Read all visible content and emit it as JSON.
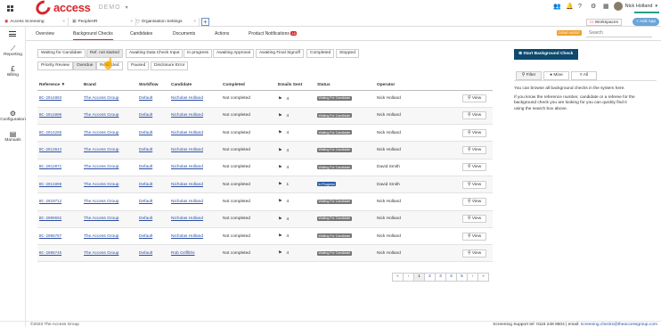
{
  "topbar": {
    "brand": "access",
    "demo_label": "DEMO",
    "user_name": "Nick Holland"
  },
  "app_tabs": [
    {
      "label": "Access Screening"
    },
    {
      "label": "PeopleHR"
    },
    {
      "label": "Organisation Settings"
    }
  ],
  "workspaces_label": "Workspaces",
  "add_app_label": "+ Add App",
  "sidebar": {
    "items": [
      {
        "label": "Reporting",
        "icon": "chart-icon"
      },
      {
        "label": "Billing",
        "icon": "pound-icon"
      },
      {
        "label": "Configuration",
        "icon": "gear-icon"
      },
      {
        "label": "Manuals",
        "icon": "book-icon"
      }
    ]
  },
  "nav": {
    "tabs": [
      {
        "label": "Overview"
      },
      {
        "label": "Background Checks"
      },
      {
        "label": "Candidates"
      },
      {
        "label": "Documents"
      },
      {
        "label": "Actions"
      },
      {
        "label": "Product Notifications",
        "badge": "19"
      }
    ],
    "demo_mode": "DEMO MODE",
    "search_placeholder": "Search"
  },
  "filters": {
    "row1": [
      "Waiting for Candidate",
      "Ref. not started",
      "Awaiting Data Check Input",
      "In progress",
      "Awaiting Approval",
      "Awaiting Final Signoff",
      "Completed",
      "Stopped"
    ],
    "row2": [
      "Priority Review",
      "Overdue",
      "Restricted",
      "Paused",
      "Disclosure Error"
    ]
  },
  "table": {
    "headers": [
      "Reference ▼",
      "Brand",
      "Workflow",
      "Candidate",
      "Completed",
      "Emails Sent",
      "Status",
      "Operator",
      ""
    ],
    "rows": [
      {
        "ref": "BC-2014803",
        "brand": "The Access Group",
        "workflow": "Default",
        "candidate": "Nicholas Holland",
        "completed": "Not completed",
        "emails": "4",
        "status": "Waiting For Candidate",
        "operator": "Nick Holland"
      },
      {
        "ref": "BC-2014800",
        "brand": "The Access Group",
        "workflow": "Default",
        "candidate": "Nicholas Holland",
        "completed": "Not completed",
        "emails": "4",
        "status": "Waiting For Candidate",
        "operator": "Nick Holland"
      },
      {
        "ref": "BC-2014266",
        "brand": "The Access Group",
        "workflow": "Default",
        "candidate": "Nicholas Holland",
        "completed": "Not completed",
        "emails": "4",
        "status": "Waiting For Candidate",
        "operator": "Nick Holland"
      },
      {
        "ref": "BC-2013643",
        "brand": "The Access Group",
        "workflow": "Default",
        "candidate": "Nicholas Holland",
        "completed": "Not completed",
        "emails": "4",
        "status": "Waiting For Candidate",
        "operator": "Nick Holland"
      },
      {
        "ref": "BC-2012071",
        "brand": "The Access Group",
        "workflow": "Default",
        "candidate": "Nicholas Holland",
        "completed": "Not completed",
        "emails": "4",
        "status": "Waiting For Candidate",
        "operator": "David Smith"
      },
      {
        "ref": "BC-2011898",
        "brand": "The Access Group",
        "workflow": "Default",
        "candidate": "Nicholas Holland",
        "completed": "Not completed",
        "emails": "1",
        "status": "In Progress",
        "operator": "David Smith"
      },
      {
        "ref": "BC-2010712",
        "brand": "The Access Group",
        "workflow": "Default",
        "candidate": "Nicholas Holland",
        "completed": "Not completed",
        "emails": "4",
        "status": "Waiting For Candidate",
        "operator": "Nick Holland"
      },
      {
        "ref": "BC-2009692",
        "brand": "The Access Group",
        "workflow": "Default",
        "candidate": "Nicholas Holland",
        "completed": "Not completed",
        "emails": "4",
        "status": "Waiting For Candidate",
        "operator": "Nick Holland"
      },
      {
        "ref": "BC-2008787",
        "brand": "The Access Group",
        "workflow": "Default",
        "candidate": "Nicholas Holland",
        "completed": "Not completed",
        "emails": "4",
        "status": "Waiting For Candidate",
        "operator": "Nick Holland"
      },
      {
        "ref": "BC-2008745",
        "brand": "The Access Group",
        "workflow": "Default",
        "candidate": "Rob Griffiths",
        "completed": "Not completed",
        "emails": "4",
        "status": "Waiting For Candidate",
        "operator": "Nick Holland"
      }
    ],
    "view_label": "View"
  },
  "pager": {
    "pages": [
      "«",
      "‹",
      "1",
      "2",
      "3",
      "4",
      "5",
      "›",
      "»"
    ],
    "current": "1"
  },
  "right_panel": {
    "start_button": "Start Background Check",
    "tabs": [
      "Filter",
      "Mine",
      "All"
    ],
    "help1": "You can browse all background checks in the system here.",
    "help2": "If you know the reference number, candidate or a referee for the background check you are looking for you can quickly find it using the search box above."
  },
  "footer": {
    "copyright": "©2023 The Access Group",
    "support_text": "Screening Support tel: 0116 248 8504 | email:",
    "support_email": "screening.checks@theaccessgroup.com"
  },
  "colors": {
    "brand_red": "#d8262c",
    "start_button": "#0c4a6e",
    "link_blue": "#2c4fa3",
    "in_progress": "#2b5fa6"
  }
}
